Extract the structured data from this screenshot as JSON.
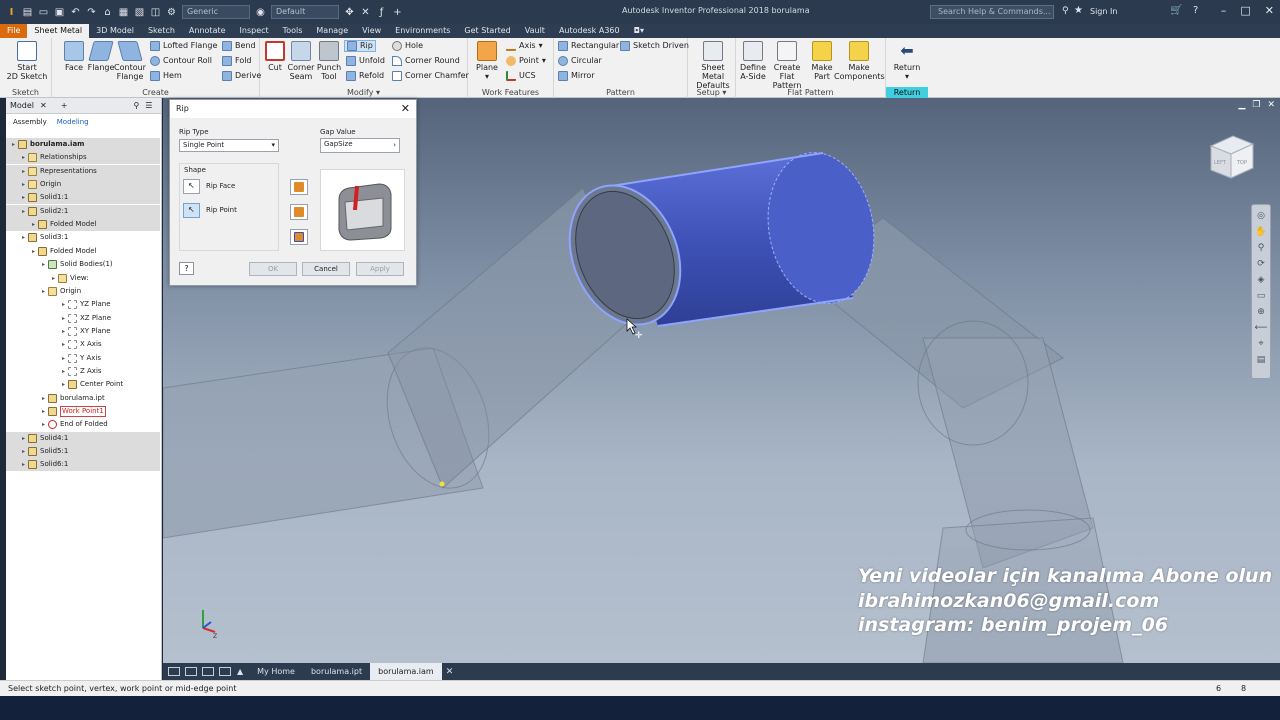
{
  "app": {
    "title": "Autodesk Inventor Professional 2018   borulama"
  },
  "quick_access": {
    "appearance_combo": "Generic",
    "material_combo": "Default"
  },
  "search": {
    "placeholder": "Search Help & Commands..."
  },
  "account": {
    "sign_in": "Sign In"
  },
  "ribbon_tabs": [
    "File",
    "Sheet Metal",
    "3D Model",
    "Sketch",
    "Annotate",
    "Inspect",
    "Tools",
    "Manage",
    "View",
    "Environments",
    "Get Started",
    "Vault",
    "Autodesk A360"
  ],
  "ribbon": {
    "sketch": {
      "name": "Sketch",
      "start_sketch": [
        "Start",
        "2D Sketch"
      ]
    },
    "create": {
      "name": "Create",
      "face": "Face",
      "flange": "Flange",
      "contour_flange": [
        "Contour",
        "Flange"
      ],
      "lofted_flange": "Lofted Flange",
      "contour_roll": "Contour Roll",
      "hem": "Hem",
      "bend": "Bend",
      "fold": "Fold",
      "derive": "Derive"
    },
    "modify": {
      "name": "Modify",
      "cut": "Cut",
      "corner_seam": [
        "Corner",
        "Seam"
      ],
      "punch_tool": [
        "Punch",
        "Tool"
      ],
      "rip": "Rip",
      "unfold": "Unfold",
      "refold": "Refold",
      "hole": "Hole",
      "corner_round": "Corner Round",
      "corner_chamfer": "Corner Chamfer"
    },
    "work_features": {
      "name": "Work Features",
      "plane": "Plane",
      "axis": "Axis",
      "point": "Point",
      "ucs": "UCS"
    },
    "pattern": {
      "name": "Pattern",
      "rectangular": "Rectangular",
      "circular": "Circular",
      "mirror": "Mirror",
      "sketch_driven": "Sketch Driven"
    },
    "setup": {
      "name": "Setup",
      "defaults": [
        "Sheet Metal",
        "Defaults"
      ]
    },
    "flat_pattern": {
      "name": "Flat Pattern",
      "define_aside": [
        "Define",
        "A-Side"
      ],
      "create_flat": [
        "Create",
        "Flat Pattern"
      ],
      "make_part": [
        "Make",
        "Part"
      ],
      "make_components": [
        "Make",
        "Components"
      ]
    },
    "return": {
      "name": "Return",
      "button": "Return"
    }
  },
  "browser": {
    "tab": "Model",
    "modes": [
      "Assembly",
      "Modeling"
    ],
    "rows": [
      {
        "label": "borulama.iam",
        "depth": 0,
        "bold": true,
        "gray": true
      },
      {
        "label": "Relationships",
        "depth": 1,
        "gray": true
      },
      {
        "label": "Representations",
        "depth": 1,
        "gray": true
      },
      {
        "label": "Origin",
        "depth": 1,
        "gray": true
      },
      {
        "label": "Solid1:1",
        "depth": 1,
        "gray": true
      },
      {
        "label": "Solid2:1",
        "depth": 1,
        "gray": true
      },
      {
        "label": "Folded Model",
        "depth": 2,
        "gray": true
      },
      {
        "label": "Solid3:1",
        "depth": 1
      },
      {
        "label": "Folded Model",
        "depth": 2
      },
      {
        "label": "Solid Bodies(1)",
        "depth": 3
      },
      {
        "label": "View:",
        "depth": 4
      },
      {
        "label": "Origin",
        "depth": 3
      },
      {
        "label": "YZ Plane",
        "depth": 5
      },
      {
        "label": "XZ Plane",
        "depth": 5
      },
      {
        "label": "XY Plane",
        "depth": 5
      },
      {
        "label": "X Axis",
        "depth": 5
      },
      {
        "label": "Y Axis",
        "depth": 5
      },
      {
        "label": "Z Axis",
        "depth": 5
      },
      {
        "label": "Center Point",
        "depth": 5
      },
      {
        "label": "borulama.ipt",
        "depth": 3
      },
      {
        "label": "Work Point1",
        "depth": 3,
        "boxed": true
      },
      {
        "label": "End of Folded",
        "depth": 3
      },
      {
        "label": "Solid4:1",
        "depth": 1,
        "gray": true
      },
      {
        "label": "Solid5:1",
        "depth": 1,
        "gray": true
      },
      {
        "label": "Solid6:1",
        "depth": 1,
        "gray": true
      }
    ]
  },
  "rip_dialog": {
    "title": "Rip",
    "rip_type_label": "Rip Type",
    "rip_type_value": "Single Point",
    "gap_label": "Gap Value",
    "gap_value": "GapSize",
    "shape_label": "Shape",
    "rip_face": "Rip Face",
    "rip_point": "Rip Point",
    "ok": "OK",
    "cancel": "Cancel",
    "apply": "Apply"
  },
  "viewcube": {
    "left": "LEFT",
    "top": "TOP"
  },
  "overlay": {
    "line1": "Yeni videolar için kanalıma Abone olun",
    "line2": "ibrahimozkan06@gmail.com",
    "line3": "instagram: benim_projem_06"
  },
  "doc_tabs": [
    "My Home",
    "borulama.ipt",
    "borulama.iam"
  ],
  "status": {
    "prompt": "Select sketch point, vertex, work point or mid-edge point",
    "count1": "6",
    "count2": "8"
  },
  "colors": {
    "accent_orange": "#d96a0d",
    "return_panel": "#3fcfe0",
    "selected_pipe": "#4a5fc8"
  }
}
